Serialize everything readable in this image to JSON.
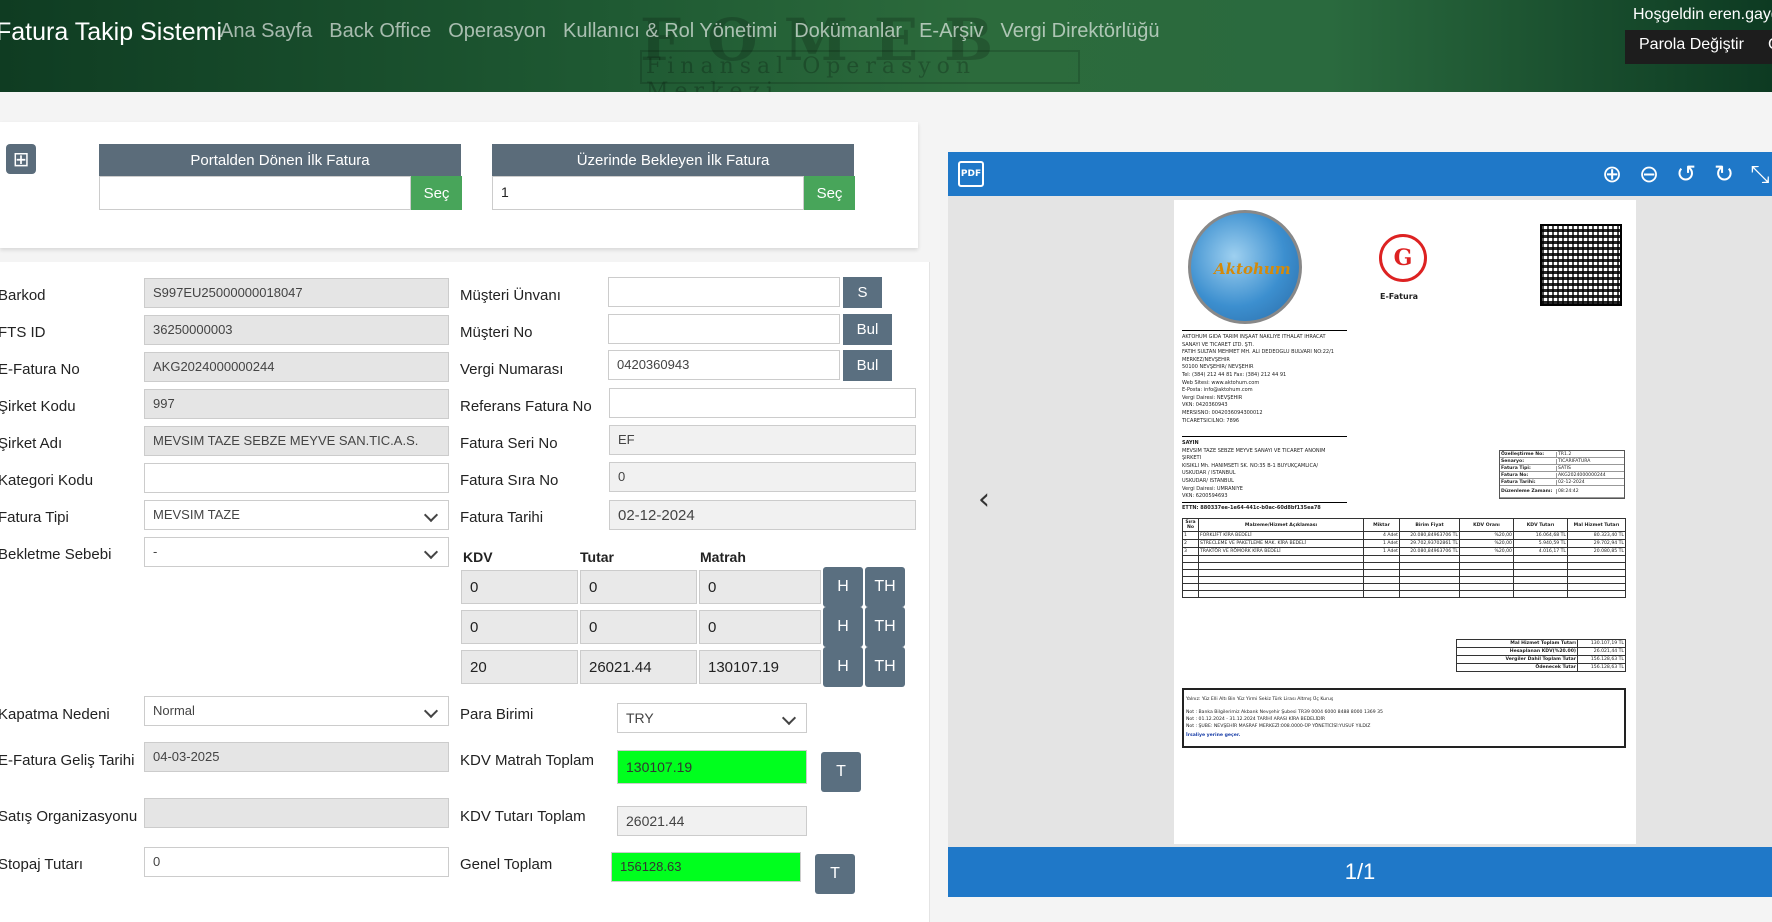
{
  "navbar": {
    "brand": "Fatura Takip Sistemi",
    "links": [
      "Ana Sayfa",
      "Back Office",
      "Operasyon",
      "Kullanıcı & Rol Yönetimi",
      "Dokümanlar",
      "E-Arşiv",
      "Vergi Direktörlüğü"
    ],
    "background_text": "FOMEB",
    "background_subtitle": "Finansal Operasyon Merkezi",
    "welcome": "Hoşgeldin eren.gaygı",
    "password_button": "Parola Değiştir",
    "next_button_partial": "Ç"
  },
  "fetch": {
    "portal_title": "Portalden Dönen İlk Fatura",
    "portal_value": "",
    "waiting_title": "Üzerinde Bekleyen İlk Fatura",
    "waiting_value": "1",
    "select_label": "Seç"
  },
  "form": {
    "left": [
      {
        "label": "Barkod",
        "value": "S997EU25000000018047"
      },
      {
        "label": "FTS ID",
        "value": "36250000003"
      },
      {
        "label": "E-Fatura No",
        "value": "AKG2024000000244"
      },
      {
        "label": "Şirket Kodu",
        "value": "997"
      },
      {
        "label": "Şirket Adı",
        "value": "MEVSIM TAZE SEBZE MEYVE SAN.TIC.A.S."
      },
      {
        "label": "Kategori Kodu",
        "value": ""
      },
      {
        "label": "Fatura Tipi",
        "value": "MEVSIM TAZE"
      },
      {
        "label": "Bekletme Sebebi",
        "value": "-"
      },
      {
        "label": "Kapatma Nedeni",
        "value": "Normal"
      },
      {
        "label": "E-Fatura Geliş Tarihi",
        "value": "04-03-2025"
      },
      {
        "label": "Satış Organizasyonu",
        "value": ""
      },
      {
        "label": "Stopaj Tutarı",
        "value": "0"
      }
    ],
    "right": [
      {
        "label": "Müşteri Ünvanı",
        "value": "",
        "button": "S"
      },
      {
        "label": "Müşteri No",
        "value": "",
        "button": "Bul"
      },
      {
        "label": "Vergi Numarası",
        "value": "0420360943",
        "button": "Bul"
      },
      {
        "label": "Referans Fatura No",
        "value": ""
      },
      {
        "label": "Fatura Seri No",
        "value": "EF"
      },
      {
        "label": "Fatura Sıra No",
        "value": "0"
      },
      {
        "label": "Fatura Tarihi",
        "value": "02-12-2024"
      }
    ],
    "kdv": {
      "headers": [
        "KDV",
        "Tutar",
        "Matrah"
      ],
      "rows": [
        {
          "kdv": "0",
          "tutar": "0",
          "matrah": "0"
        },
        {
          "kdv": "0",
          "tutar": "0",
          "matrah": "0"
        },
        {
          "kdv": "20",
          "tutar": "26021.44",
          "matrah": "130107.19"
        }
      ],
      "h_label": "H",
      "th_label": "TH"
    },
    "totals": [
      {
        "label": "Para Birimi",
        "value": "TRY"
      },
      {
        "label": "KDV Matrah Toplam",
        "value": "130107.19",
        "button": "T"
      },
      {
        "label": "KDV Tutarı Toplam",
        "value": "26021.44"
      },
      {
        "label": "Genel Toplam",
        "value": "156128.63",
        "button": "T"
      }
    ]
  },
  "pdf": {
    "icon_label": "PDF",
    "page_indicator": "1/1",
    "logo_text": "Aktohum",
    "efatura_label": "E-Fatura",
    "seller_lines": [
      "AKTOHUM GIDA TARIM İNŞAAT NAKLİYE İTHALAT İHRACAT",
      "SANAYİ VE TİCARET LTD. ŞTİ.",
      "FATİH SULTAN MEHMET MH. ALİ DEDEOĞLU BULVARI NO:22/1",
      "MERKEZ/NEVŞEHİR",
      "50100 NEVŞEHİR/ NEVŞEHİR",
      "Tel: (384) 212 44 81 Fax: (384) 212 44 91",
      "Web Sitesi: www.aktohum.com",
      "E-Posta: info@aktohum.com",
      "Vergi Dairesi: NEVŞEHİR",
      "VKN: 0420360943",
      "MERSİSNO: 0042036094300012",
      "TİCARETSİCİLNO: 7896"
    ],
    "buyer_lines": [
      "SAYIN",
      "MEVSİM TAZE SEBZE MEYVE SANAYİ VE TİCARET ANONİM",
      "ŞİRKETİ",
      "KİSIKLI Mh. HANIMSETİ SK. NO:35 B-1 BÜYÜKÇAMLICA/",
      "ÜSKÜDAR / İSTANBUL",
      "ÜSKÜDAR/ İSTANBUL",
      "Vergi Dairesi: ÜMRANİYE",
      "VKN: 6200594693"
    ],
    "ettn": "ETTN: 880337ee-1e64-441c-b0ac-60d8bf135ea78",
    "info": [
      {
        "k": "Özelleştirme No:",
        "v": "TR1.2"
      },
      {
        "k": "Senaryo:",
        "v": "TICARIFATURA"
      },
      {
        "k": "Fatura Tipi:",
        "v": "SATIS"
      },
      {
        "k": "Fatura No:",
        "v": "AKG2024000000244"
      },
      {
        "k": "Fatura Tarihi:",
        "v": "02-12-2024"
      },
      {
        "k": "Düzenleme Zamanı:",
        "v": "08:24:42"
      }
    ],
    "items_headers": [
      "Sıra No",
      "Malzeme/Hizmet Açıklaması",
      "Miktar",
      "Birim Fiyat",
      "KDV Oranı",
      "KDV Tutarı",
      "Mal Hizmet Tutarı"
    ],
    "items": [
      [
        "1",
        "FORKLİFT KİRA BEDELİ",
        "4 Adet",
        "20.080,84963706 TL",
        "%20,00",
        "16.064,68 TL",
        "80.323,40 TL"
      ],
      [
        "2",
        "STRECLEME VE PAKETLEME MAK. KİRA BEDELİ",
        "1 Adet",
        "29.702,93702861 TL",
        "%20,00",
        "5.940,59 TL",
        "29.702,94 TL"
      ],
      [
        "3",
        "TRAKTÖR VE RÖMORK KİRA BEDELİ",
        "1 Adet",
        "20.080,84963706 TL",
        "%20,00",
        "4.016,17 TL",
        "20.080,85 TL"
      ]
    ],
    "totals": [
      {
        "k": "Mal Hizmet Toplam Tutarı",
        "v": "130.107,19 TL"
      },
      {
        "k": "Hesaplanan KDV(%20.00)",
        "v": "26.021,44 TL"
      },
      {
        "k": "Vergiler Dahil Toplam Tutar",
        "v": "156.128,63 TL"
      },
      {
        "k": "Ödenecek Tutar",
        "v": "156.128,63 TL"
      }
    ],
    "notes": [
      "Yalnız: Yüz Elli Altı Bin Yüz Yirmi Sekiz Türk Lirası Altmış Üç Kuruş",
      "Not : Banka Bilgilerimiz Akbank Nevşehir Şubesi TR39 0004 6000 8488 8000 1369 35",
      "Not : 01.12.2024 - 31.12.2024 TARİHİ ARASI KİRA BEDELİDİR",
      "Not : ŞUBE: NEVŞEHİR MASRAF MERKEZİ:008.0000-ÜP YÖNETİCİSİ:YUSUF YILDIZ"
    ],
    "dispatch_link": "İrsaliye yerine geçer."
  },
  "colors": {
    "navbar": "#1f5a33",
    "slate_button": "#5a6f80",
    "green_button": "#48a55a",
    "highlight_green": "#00ff1e",
    "pdf_blue": "#1f78c8"
  }
}
